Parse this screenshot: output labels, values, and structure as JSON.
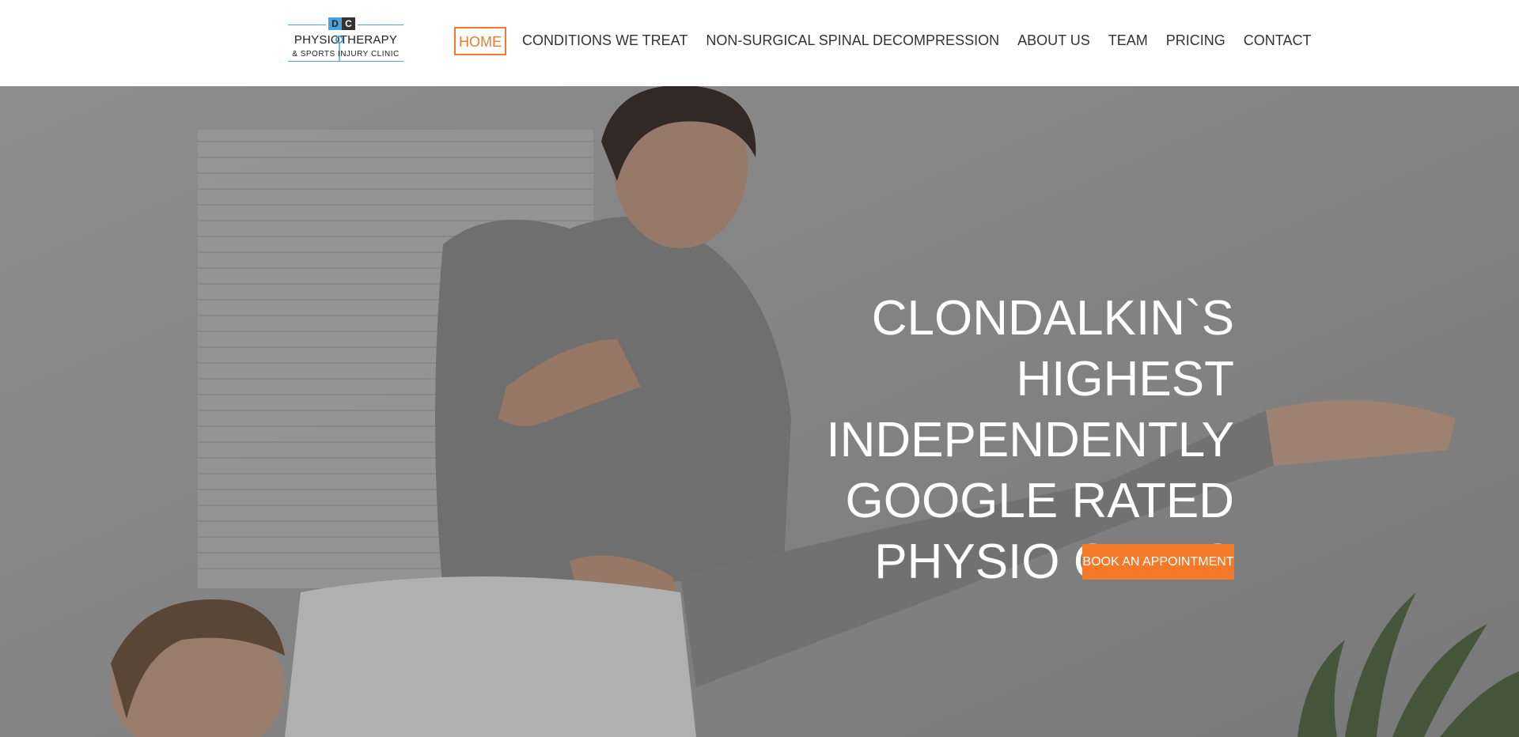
{
  "logo": {
    "badge_left": "D",
    "badge_right": "C",
    "title": "PHYSIOTHERAPY",
    "subtitle": "& SPORTS INJURY CLINIC"
  },
  "nav": {
    "items": [
      {
        "label": "HOME",
        "active": true
      },
      {
        "label": "CONDITIONS WE TREAT",
        "active": false
      },
      {
        "label": "NON-SURGICAL SPINAL DECOMPRESSION",
        "active": false
      },
      {
        "label": "ABOUT US",
        "active": false
      },
      {
        "label": "TEAM",
        "active": false
      },
      {
        "label": "PRICING",
        "active": false
      },
      {
        "label": "CONTACT",
        "active": false
      }
    ]
  },
  "hero": {
    "headline_lines": [
      "CLONDALKIN`S",
      "HIGHEST",
      "INDEPENDENTLY",
      "GOOGLE RATED",
      "PHYSIO CLINIC"
    ],
    "cta_label": "BOOK AN APPOINTMENT"
  },
  "colors": {
    "accent": "#f47a2a",
    "logo_blue": "#4aa3df",
    "nav_text": "#333333",
    "headline": "#ffffff"
  }
}
